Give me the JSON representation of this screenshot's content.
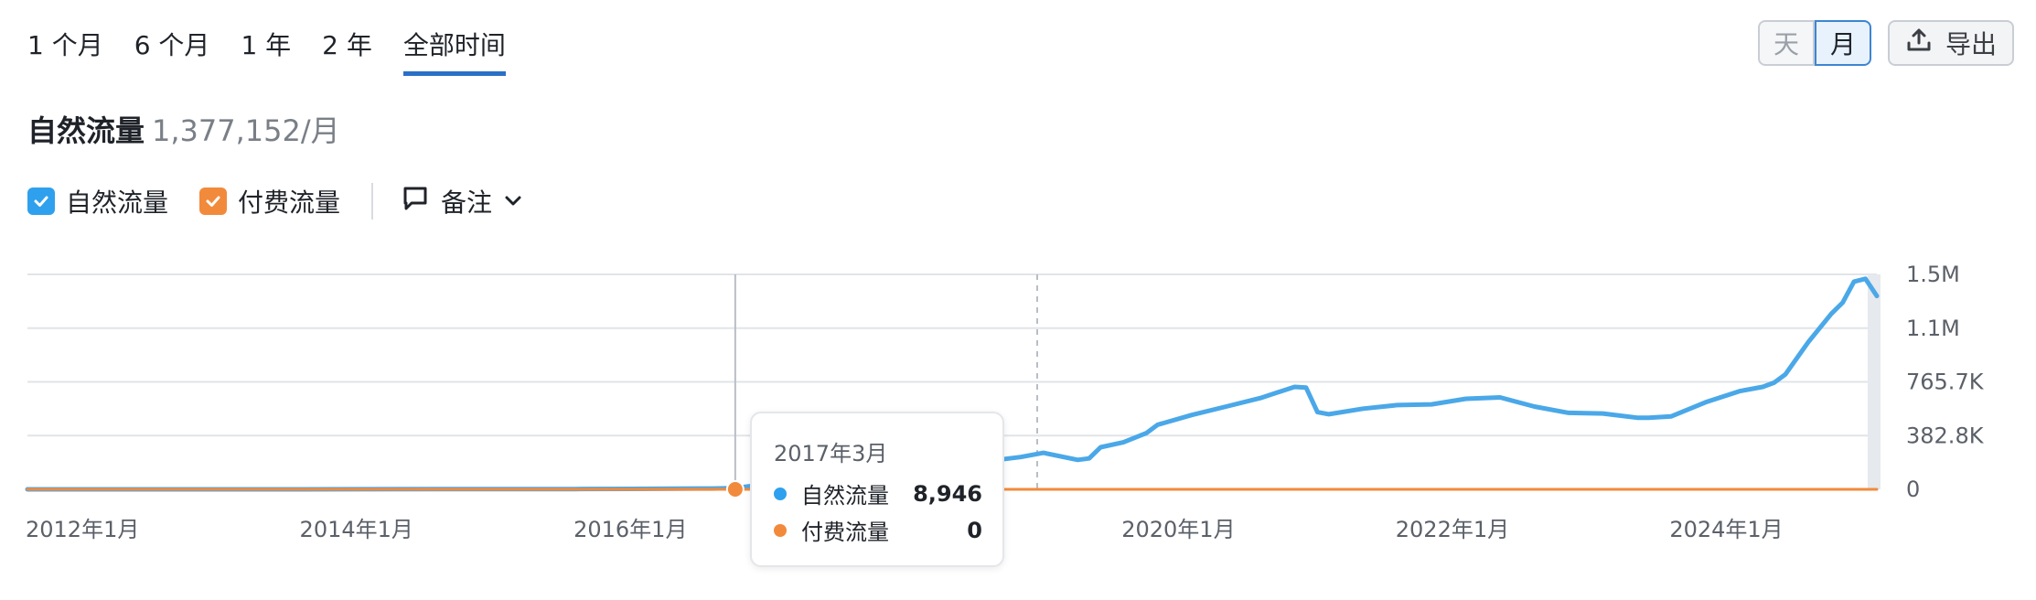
{
  "tabs": [
    "1 个月",
    "6 个月",
    "1 年",
    "2 年",
    "全部时间"
  ],
  "active_tab": 4,
  "granularity": {
    "day_label": "天",
    "month_label": "月"
  },
  "export_label": "导出",
  "headline": {
    "label": "自然流量",
    "value": "1,377,152/月"
  },
  "legend": {
    "organic": "自然流量",
    "paid": "付费流量",
    "notes": "备注"
  },
  "colors": {
    "organic": "#4aa8e8",
    "paid": "#f28a3c",
    "grid": "#e1e4e8",
    "accent": "#2a70c6"
  },
  "tooltip": {
    "date": "2017年3月",
    "rows": [
      {
        "name": "自然流量",
        "value": "8,946",
        "color": "#2fa0ee"
      },
      {
        "name": "付费流量",
        "value": "0",
        "color": "#f28a3c"
      }
    ]
  },
  "chart_data": {
    "type": "line",
    "x_ticks": [
      "2012年1月",
      "2014年1月",
      "2016年1月",
      "2018年1月",
      "2020年1月",
      "2022年1月",
      "2024年1月"
    ],
    "y_ticks": [
      "1.5M",
      "1.1M",
      "765.7K",
      "382.8K",
      "0"
    ],
    "ylim": [
      0,
      1531200
    ],
    "xlim": [
      "2012-01",
      "2025-07"
    ],
    "grid": true,
    "hover_date": "2017-03",
    "series": [
      {
        "name": "自然流量",
        "color": "#4aa8e8",
        "x": [
          "2012-01",
          "2013-01",
          "2014-01",
          "2015-01",
          "2016-01",
          "2016-06",
          "2017-01",
          "2017-03",
          "2017-06",
          "2018-01",
          "2018-06",
          "2019-01",
          "2019-04",
          "2019-06",
          "2019-09",
          "2019-10",
          "2019-11",
          "2020-01",
          "2020-03",
          "2020-04",
          "2020-07",
          "2020-10",
          "2021-01",
          "2021-04",
          "2021-05",
          "2021-06",
          "2021-07",
          "2021-10",
          "2022-01",
          "2022-04",
          "2022-07",
          "2022-10",
          "2023-01",
          "2023-04",
          "2023-07",
          "2023-10",
          "2023-11",
          "2024-01",
          "2024-04",
          "2024-07",
          "2024-09",
          "2024-10",
          "2024-11",
          "2025-01",
          "2025-03",
          "2025-04",
          "2025-05",
          "2025-06",
          "2025-07"
        ],
        "y": [
          0,
          0,
          0,
          1000,
          2000,
          3000,
          6000,
          8946,
          40000,
          130000,
          180000,
          200000,
          230000,
          260000,
          210000,
          220000,
          300000,
          335000,
          400000,
          460000,
          530000,
          590000,
          650000,
          730000,
          725000,
          550000,
          535000,
          575000,
          600000,
          605000,
          645000,
          655000,
          590000,
          545000,
          540000,
          510000,
          510000,
          520000,
          620000,
          700000,
          730000,
          760000,
          820000,
          1050000,
          1250000,
          1330000,
          1480000,
          1500000,
          1377152
        ]
      },
      {
        "name": "付费流量",
        "color": "#f28a3c",
        "x": [
          "2012-01",
          "2025-07"
        ],
        "y": [
          0,
          0
        ]
      }
    ]
  }
}
